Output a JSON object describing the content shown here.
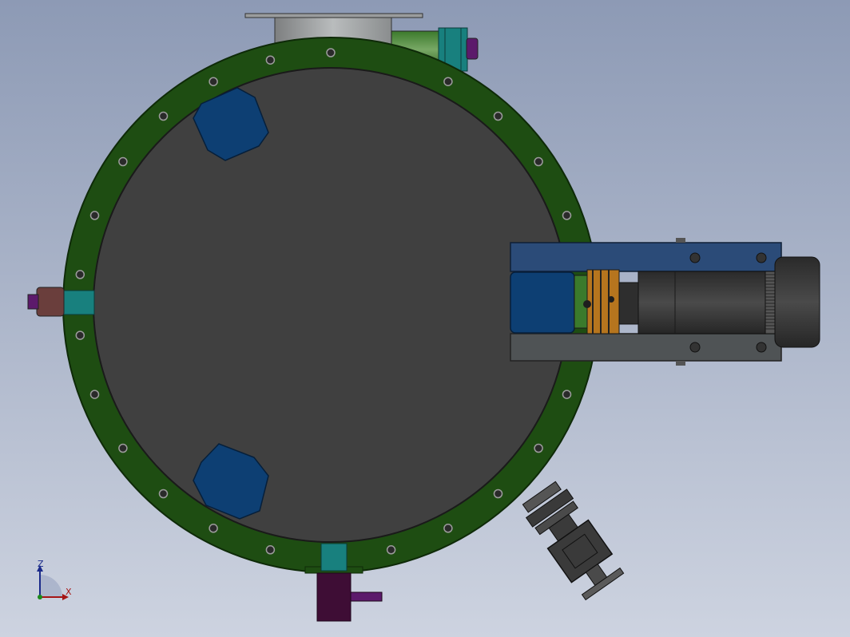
{
  "triad": {
    "z_label": "Z",
    "x_label": "X"
  },
  "colors": {
    "bg_top": "#8d9ab5",
    "bg_bottom": "#cdd3e0",
    "flange_ring": "#1e4d12",
    "vessel_face": "#404040",
    "blue_pad": "#0d3f73",
    "teal_fitting": "#18807e",
    "purple_pipe": "#3e0d35",
    "motor_body": "#3a3a3a",
    "bracket_top": "#2b4b78",
    "bracket_bottom": "#4f5355",
    "gear_orange": "#b6751e"
  }
}
